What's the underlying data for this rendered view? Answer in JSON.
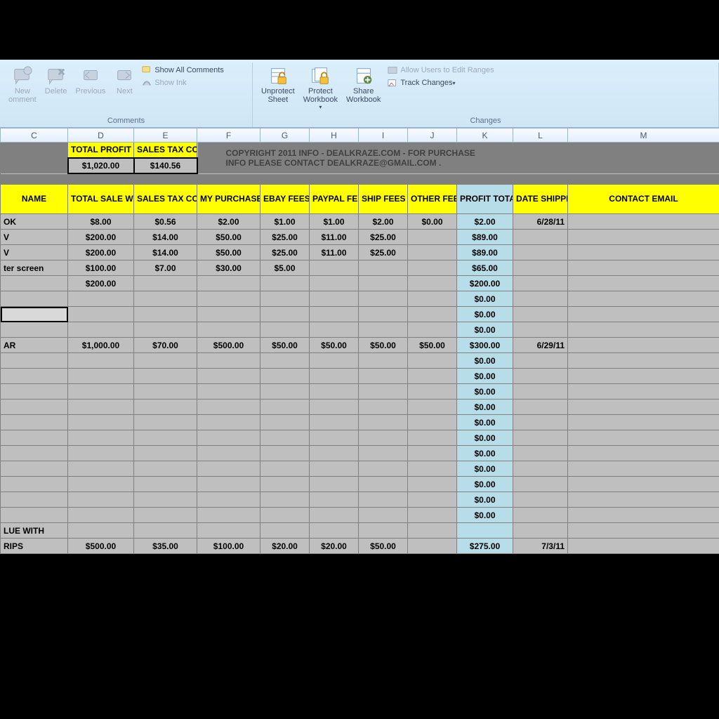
{
  "ribbon": {
    "comments": {
      "new": "New",
      "new2": "omment",
      "delete": "Delete",
      "previous": "Previous",
      "next": "Next",
      "showAll": "Show All Comments",
      "showInk": "Show Ink",
      "groupLabel": "Comments"
    },
    "changes": {
      "unprotect": "Unprotect\nSheet",
      "protectWb": "Protect\nWorkbook",
      "shareWb": "Share\nWorkbook",
      "allowUsers": "Allow Users to Edit Ranges",
      "track": "Track Changes",
      "groupLabel": "Changes"
    }
  },
  "columns": [
    "C",
    "D",
    "E",
    "F",
    "G",
    "H",
    "I",
    "J",
    "K",
    "L",
    "M"
  ],
  "kpi": {
    "profitLabel": "TOTAL PROFIT",
    "profitValue": "$1,020.00",
    "taxLabel": "SALES TAX COLLECTED",
    "taxValue": "$140.56"
  },
  "copyright": {
    "line1": "COPYRIGHT  2011 INFO -    DEALKRAZE.COM - FOR PURCHASE",
    "line2": "INFO PLEASE CONTACT DEALKRAZE@GMAIL.COM ."
  },
  "headers": {
    "name": "NAME",
    "totalSale": "TOTAL SALE W/ SHIPPING",
    "taxCollected": "SALES TAX COLLECTED",
    "myPurchase": "MY PURCHASE PRICE",
    "ebay": "EBAY FEES",
    "paypal": "PAYPAL FEES",
    "ship": "SHIP FEES",
    "other": "OTHER FEES",
    "profit": "PROFIT TOTAL",
    "dateShipped": "DATE SHIPPED",
    "email": "CONTACT EMAIL"
  },
  "rows": [
    {
      "name": "OK",
      "total": "$8.00",
      "tax": "$0.56",
      "pp": "$2.00",
      "ebay": "$1.00",
      "paypal": "$1.00",
      "ship": "$2.00",
      "other": "$0.00",
      "profit": "$2.00",
      "date": "6/28/11"
    },
    {
      "name": "V",
      "total": "$200.00",
      "tax": "$14.00",
      "pp": "$50.00",
      "ebay": "$25.00",
      "paypal": "$11.00",
      "ship": "$25.00",
      "other": "",
      "profit": "$89.00",
      "date": ""
    },
    {
      "name": "V",
      "total": "$200.00",
      "tax": "$14.00",
      "pp": "$50.00",
      "ebay": "$25.00",
      "paypal": "$11.00",
      "ship": "$25.00",
      "other": "",
      "profit": "$89.00",
      "date": ""
    },
    {
      "name": "ter screen",
      "total": "$100.00",
      "tax": "$7.00",
      "pp": "$30.00",
      "ebay": "$5.00",
      "paypal": "",
      "ship": "",
      "other": "",
      "profit": "$65.00",
      "date": ""
    },
    {
      "name": "",
      "total": "$200.00",
      "tax": "",
      "pp": "",
      "ebay": "",
      "paypal": "",
      "ship": "",
      "other": "",
      "profit": "$200.00",
      "date": ""
    },
    {
      "name": "",
      "total": "",
      "tax": "",
      "pp": "",
      "ebay": "",
      "paypal": "",
      "ship": "",
      "other": "",
      "profit": "$0.00",
      "date": ""
    },
    {
      "name": "",
      "total": "",
      "tax": "",
      "pp": "",
      "ebay": "",
      "paypal": "",
      "ship": "",
      "other": "",
      "profit": "$0.00",
      "date": "",
      "selected": true
    },
    {
      "name": "",
      "total": "",
      "tax": "",
      "pp": "",
      "ebay": "",
      "paypal": "",
      "ship": "",
      "other": "",
      "profit": "$0.00",
      "date": ""
    },
    {
      "name": "AR",
      "total": "$1,000.00",
      "tax": "$70.00",
      "pp": "$500.00",
      "ebay": "$50.00",
      "paypal": "$50.00",
      "ship": "$50.00",
      "other": "$50.00",
      "profit": "$300.00",
      "date": "6/29/11"
    },
    {
      "name": "",
      "total": "",
      "tax": "",
      "pp": "",
      "ebay": "",
      "paypal": "",
      "ship": "",
      "other": "",
      "profit": "$0.00",
      "date": ""
    },
    {
      "name": "",
      "total": "",
      "tax": "",
      "pp": "",
      "ebay": "",
      "paypal": "",
      "ship": "",
      "other": "",
      "profit": "$0.00",
      "date": ""
    },
    {
      "name": "",
      "total": "",
      "tax": "",
      "pp": "",
      "ebay": "",
      "paypal": "",
      "ship": "",
      "other": "",
      "profit": "$0.00",
      "date": ""
    },
    {
      "name": "",
      "total": "",
      "tax": "",
      "pp": "",
      "ebay": "",
      "paypal": "",
      "ship": "",
      "other": "",
      "profit": "$0.00",
      "date": ""
    },
    {
      "name": "",
      "total": "",
      "tax": "",
      "pp": "",
      "ebay": "",
      "paypal": "",
      "ship": "",
      "other": "",
      "profit": "$0.00",
      "date": ""
    },
    {
      "name": "",
      "total": "",
      "tax": "",
      "pp": "",
      "ebay": "",
      "paypal": "",
      "ship": "",
      "other": "",
      "profit": "$0.00",
      "date": ""
    },
    {
      "name": "",
      "total": "",
      "tax": "",
      "pp": "",
      "ebay": "",
      "paypal": "",
      "ship": "",
      "other": "",
      "profit": "$0.00",
      "date": ""
    },
    {
      "name": "",
      "total": "",
      "tax": "",
      "pp": "",
      "ebay": "",
      "paypal": "",
      "ship": "",
      "other": "",
      "profit": "$0.00",
      "date": ""
    },
    {
      "name": "",
      "total": "",
      "tax": "",
      "pp": "",
      "ebay": "",
      "paypal": "",
      "ship": "",
      "other": "",
      "profit": "$0.00",
      "date": ""
    },
    {
      "name": "",
      "total": "",
      "tax": "",
      "pp": "",
      "ebay": "",
      "paypal": "",
      "ship": "",
      "other": "",
      "profit": "$0.00",
      "date": ""
    },
    {
      "name": "",
      "total": "",
      "tax": "",
      "pp": "",
      "ebay": "",
      "paypal": "",
      "ship": "",
      "other": "",
      "profit": "$0.00",
      "date": ""
    },
    {
      "name": "LUE WITH",
      "total": "",
      "tax": "",
      "pp": "",
      "ebay": "",
      "paypal": "",
      "ship": "",
      "other": "",
      "profit": "",
      "date": ""
    },
    {
      "name": "RIPS",
      "total": "$500.00",
      "tax": "$35.00",
      "pp": "$100.00",
      "ebay": "$20.00",
      "paypal": "$20.00",
      "ship": "$50.00",
      "other": "",
      "profit": "$275.00",
      "date": "7/3/11"
    }
  ]
}
